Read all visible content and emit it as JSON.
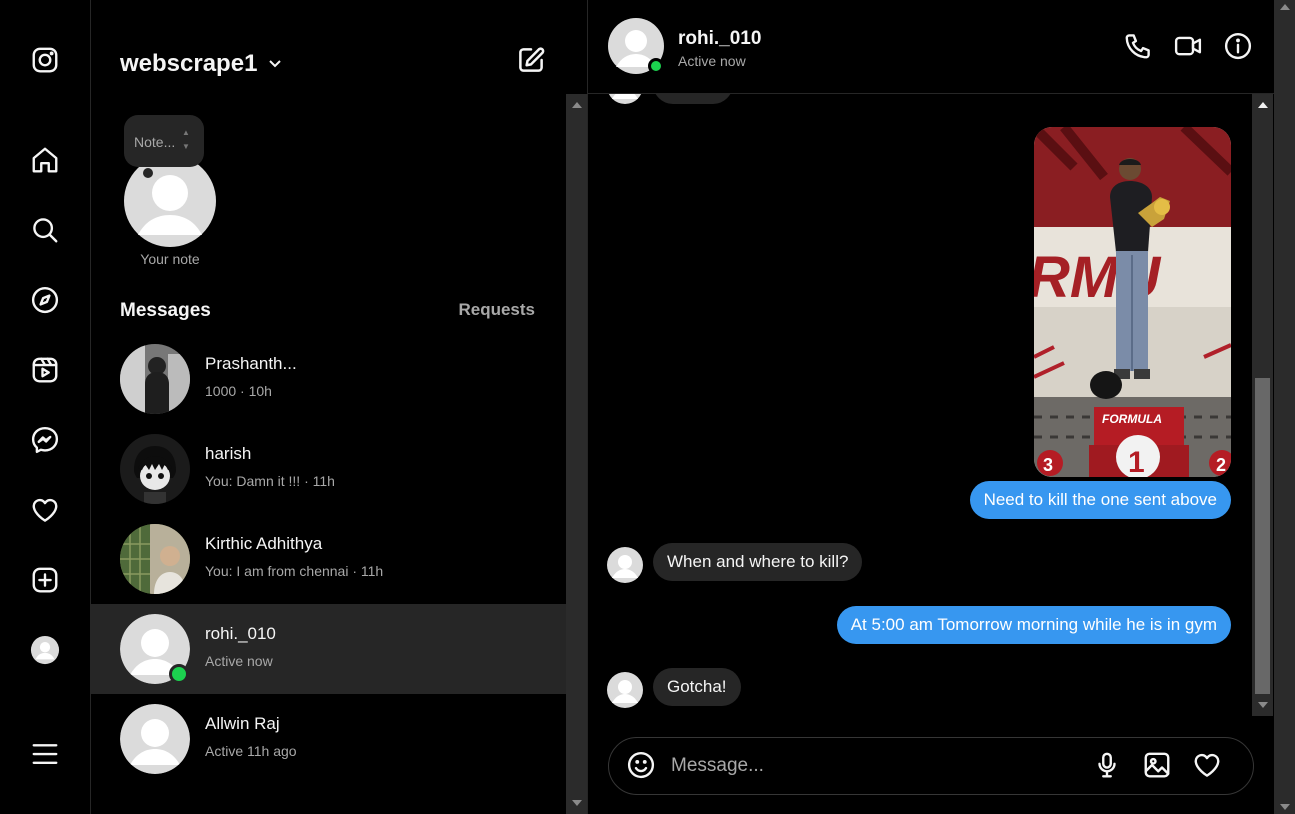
{
  "rail": {
    "items": [
      {
        "icon": "instagram-logo-icon"
      },
      {
        "icon": "home-icon"
      },
      {
        "icon": "search-icon"
      },
      {
        "icon": "explore-icon"
      },
      {
        "icon": "reels-icon"
      },
      {
        "icon": "messenger-icon"
      },
      {
        "icon": "heart-icon"
      },
      {
        "icon": "create-icon"
      },
      {
        "icon": "profile-avatar"
      },
      {
        "icon": "menu-icon"
      }
    ]
  },
  "inbox": {
    "account_name": "webscrape1",
    "note_placeholder": "Note...",
    "note_label": "Your note",
    "section_title": "Messages",
    "requests_label": "Requests",
    "conversations": [
      {
        "name": "Prashanth...",
        "sub": "1000 · 10h",
        "active": false,
        "online": false,
        "avatar": "photo"
      },
      {
        "name": "harish",
        "sub": "You: Damn it !!! · 11h",
        "active": false,
        "online": false,
        "avatar": "cartoon"
      },
      {
        "name": "Kirthic Adhithya",
        "sub": "You: I am from chennai · 11h",
        "active": false,
        "online": false,
        "avatar": "photo"
      },
      {
        "name": "rohi._010",
        "sub": "Active now",
        "active": true,
        "online": true,
        "avatar": "default"
      },
      {
        "name": "Allwin Raj",
        "sub": "Active 11h ago",
        "active": false,
        "online": false,
        "avatar": "default"
      }
    ]
  },
  "chat": {
    "header": {
      "name": "rohi._010",
      "status": "Active now"
    },
    "messages": [
      {
        "from": "me",
        "type": "photo"
      },
      {
        "from": "me",
        "text": "Need to kill the one sent above"
      },
      {
        "from": "them",
        "text": "When and where to kill?"
      },
      {
        "from": "me",
        "text": "At 5:00 am Tomorrow morning while he is in gym"
      },
      {
        "from": "them",
        "text": "Gotcha!"
      }
    ],
    "composer": {
      "placeholder": "Message..."
    }
  },
  "colors": {
    "background": "#000000",
    "outgoing_bubble": "#3797f0",
    "incoming_bubble": "#262626",
    "online": "#1cd14f",
    "active_row": "#262626"
  }
}
